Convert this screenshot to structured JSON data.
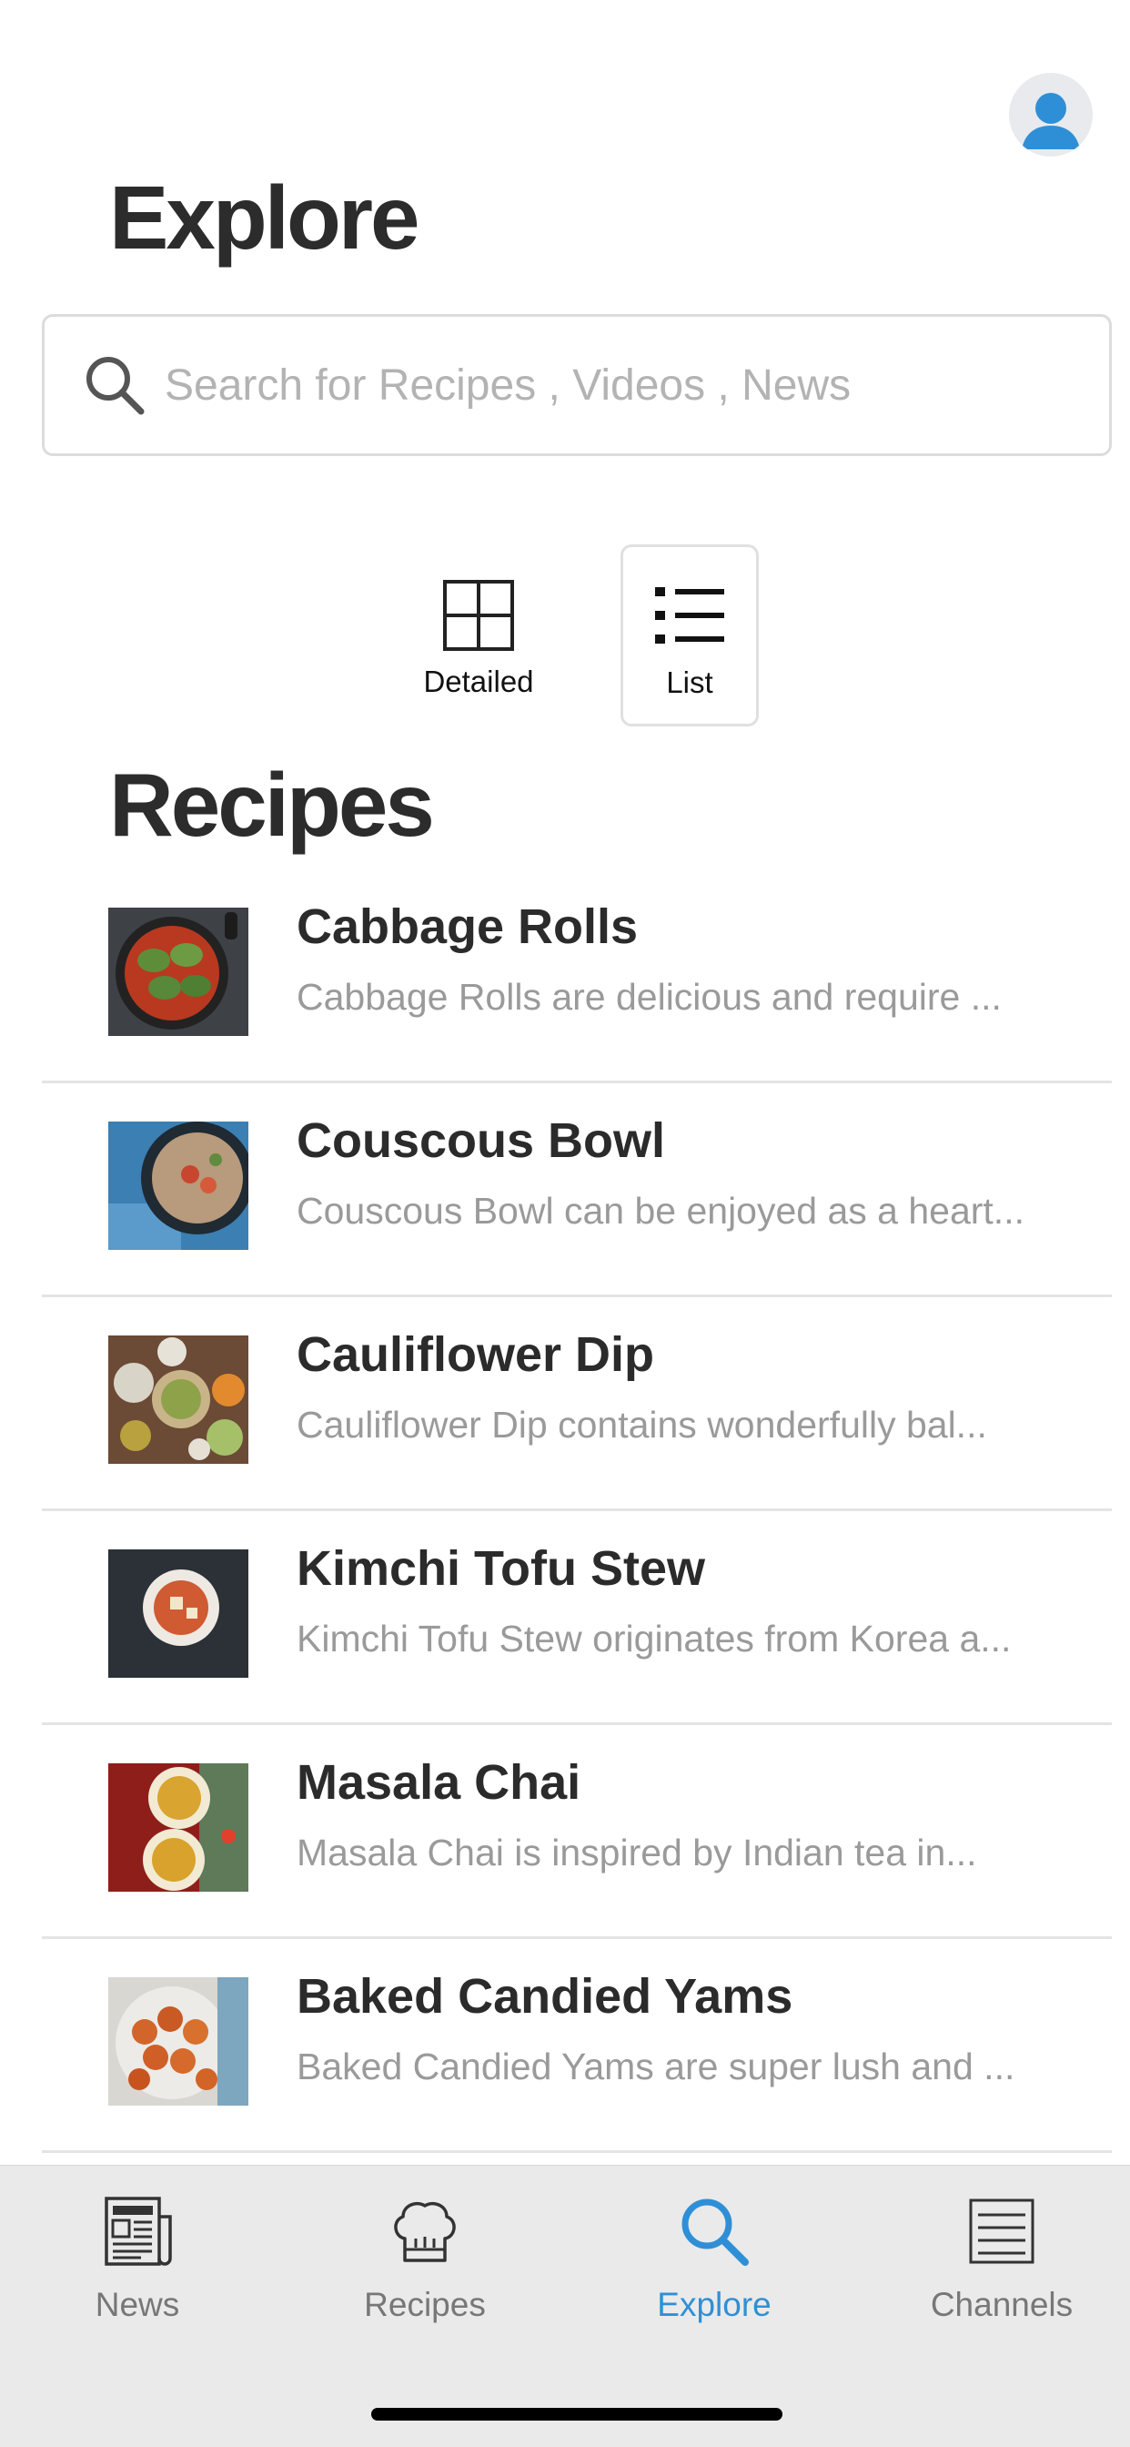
{
  "header": {
    "title": "Explore"
  },
  "search": {
    "placeholder": "Search for Recipes , Videos , News"
  },
  "view_toggle": {
    "detailed_label": "Detailed",
    "list_label": "List",
    "selected": "List"
  },
  "recipes": {
    "title": "Recipes",
    "items": [
      {
        "name": "Cabbage Rolls",
        "description": "Cabbage Rolls are delicious and require ..."
      },
      {
        "name": "Couscous Bowl",
        "description": "Couscous Bowl can be enjoyed as a heart..."
      },
      {
        "name": "Cauliflower Dip",
        "description": "Cauliflower Dip contains wonderfully bal..."
      },
      {
        "name": "Kimchi Tofu Stew",
        "description": "Kimchi Tofu Stew originates from Korea a..."
      },
      {
        "name": "Masala Chai",
        "description": "Masala Chai is inspired by Indian tea in..."
      },
      {
        "name": "Baked Candied Yams",
        "description": "Baked Candied Yams are super lush and ..."
      }
    ]
  },
  "tabs": {
    "news": "News",
    "recipes": "Recipes",
    "explore": "Explore",
    "channels": "Channels",
    "active": "Explore"
  },
  "icons": {
    "avatar": "user-avatar-icon",
    "search": "search-icon",
    "detailed": "grid-icon",
    "list": "list-icon",
    "news": "newspaper-icon",
    "recipes": "chef-hat-icon",
    "explore": "search-icon",
    "channels": "channels-list-icon"
  },
  "colors": {
    "accent": "#2f8fd6",
    "avatar_bg": "#e8eaee",
    "tab_bar_bg": "#e9e9e9",
    "text_primary": "#2b2b2b",
    "text_secondary": "#9a9a9a"
  }
}
